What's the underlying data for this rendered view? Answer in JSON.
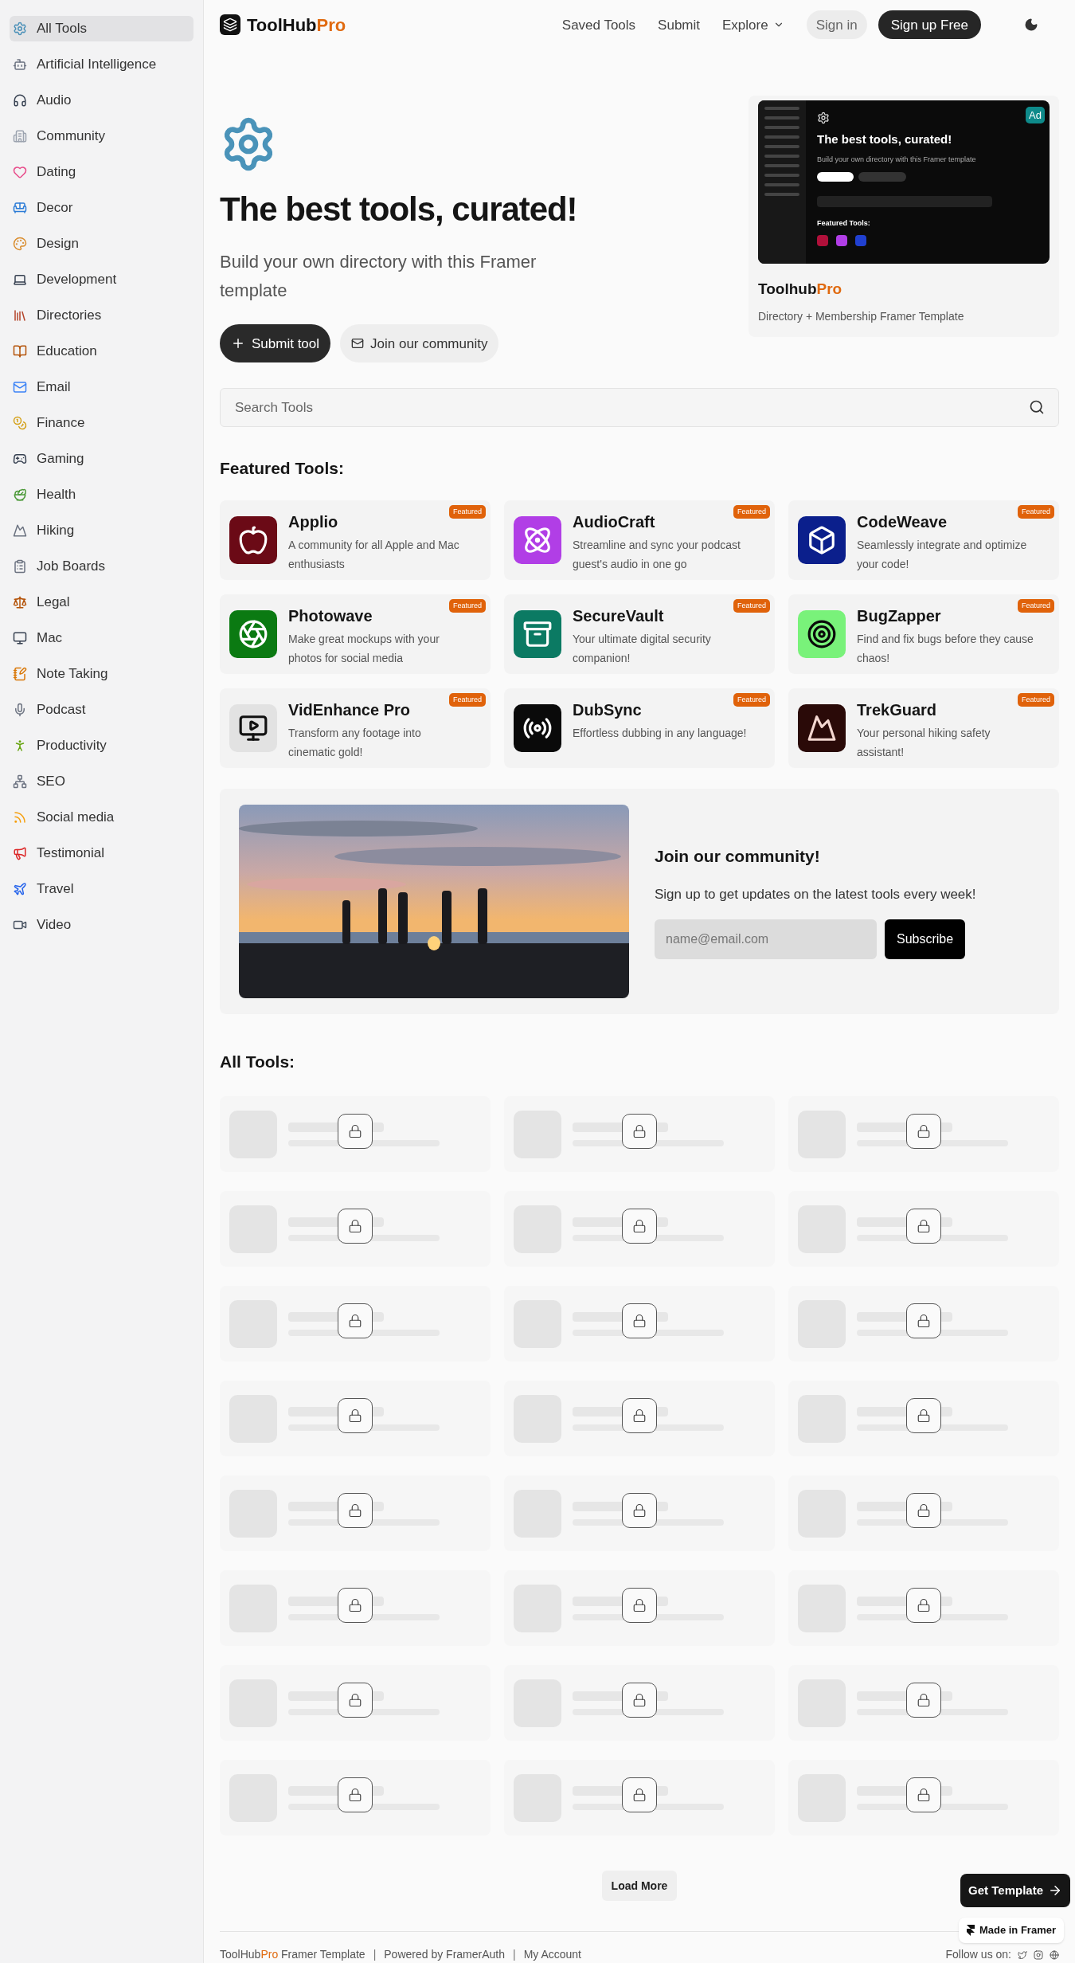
{
  "sidebar": {
    "items": [
      {
        "label": "All Tools",
        "selected": true
      },
      {
        "label": "Artificial Intelligence",
        "selected": false
      },
      {
        "label": "Audio",
        "selected": false
      },
      {
        "label": "Community",
        "selected": false
      },
      {
        "label": "Dating",
        "selected": false
      },
      {
        "label": "Decor",
        "selected": false
      },
      {
        "label": "Design",
        "selected": false
      },
      {
        "label": "Development",
        "selected": false
      },
      {
        "label": "Directories",
        "selected": false
      },
      {
        "label": "Education",
        "selected": false
      },
      {
        "label": "Email",
        "selected": false
      },
      {
        "label": "Finance",
        "selected": false
      },
      {
        "label": "Gaming",
        "selected": false
      },
      {
        "label": "Health",
        "selected": false
      },
      {
        "label": "Hiking",
        "selected": false
      },
      {
        "label": "Job Boards",
        "selected": false
      },
      {
        "label": "Legal",
        "selected": false
      },
      {
        "label": "Mac",
        "selected": false
      },
      {
        "label": "Note Taking",
        "selected": false
      },
      {
        "label": "Podcast",
        "selected": false
      },
      {
        "label": "Productivity",
        "selected": false
      },
      {
        "label": "SEO",
        "selected": false
      },
      {
        "label": "Social media",
        "selected": false
      },
      {
        "label": "Testimonial",
        "selected": false
      },
      {
        "label": "Travel",
        "selected": false
      },
      {
        "label": "Video",
        "selected": false
      }
    ]
  },
  "header": {
    "logo": {
      "name": "ToolHub",
      "suffix": "Pro"
    },
    "nav": [
      "Saved Tools",
      "Submit",
      "Explore"
    ],
    "sign_in": "Sign in",
    "sign_up": "Sign up Free"
  },
  "hero": {
    "title": "The best tools, curated!",
    "subtitle": "Build your own directory with this Framer template",
    "primary_button": "Submit tool",
    "secondary_button": "Join our community"
  },
  "ad": {
    "badge": "Ad",
    "name": "Toolhub",
    "name_suffix": "Pro",
    "description": "Directory + Membership Framer Template",
    "preview": {
      "title": "The best tools, curated!",
      "subtitle": "Build your own directory with this Framer template",
      "section": "Featured Tools:"
    }
  },
  "search": {
    "placeholder": "Search Tools"
  },
  "featured": {
    "title": "Featured Tools:",
    "tools": [
      {
        "name": "Applio",
        "description": "A community for all Apple and Mac enthusiasts",
        "badge": "Featured",
        "color": "#6b0a16"
      },
      {
        "name": "AudioCraft",
        "description": "Streamline and sync your podcast guest's audio in one go",
        "badge": "Featured",
        "color": "#b13ee6"
      },
      {
        "name": "CodeWeave",
        "description": "Seamlessly integrate and optimize your code!",
        "badge": "Featured",
        "color": "#0b1f8c"
      },
      {
        "name": "Photowave",
        "description": "Make great mockups with your photos for social media",
        "badge": "Featured",
        "color": "#0b7a12"
      },
      {
        "name": "SecureVault",
        "description": "Your ultimate digital security companion!",
        "badge": "Featured",
        "color": "#0b7a63"
      },
      {
        "name": "BugZapper",
        "description": "Find and fix bugs before they cause chaos!",
        "badge": "Featured",
        "color": "#79f27a"
      },
      {
        "name": "VidEnhance Pro",
        "description": "Transform any footage into cinematic gold!",
        "badge": "Featured",
        "color": "#e2e2e2"
      },
      {
        "name": "DubSync",
        "description": "Effortless dubbing in any language!",
        "badge": "Featured",
        "color": "#0a0a0a"
      },
      {
        "name": "TrekGuard",
        "description": "Your personal hiking safety assistant!",
        "badge": "Featured",
        "color": "#2a0a08"
      }
    ]
  },
  "community": {
    "title": "Join our community!",
    "text": "Sign up to get updates on the latest tools every week!",
    "email_placeholder": "name@email.com",
    "button": "Subscribe"
  },
  "all_tools": {
    "title": "All Tools:",
    "tools": [
      {
        "locked": true
      },
      {
        "locked": true
      },
      {
        "locked": true
      },
      {
        "locked": true
      },
      {
        "locked": true
      },
      {
        "locked": true
      },
      {
        "locked": true
      },
      {
        "locked": true
      },
      {
        "locked": true
      },
      {
        "locked": true
      },
      {
        "locked": true
      },
      {
        "locked": true
      },
      {
        "locked": true
      },
      {
        "locked": true
      },
      {
        "locked": true
      },
      {
        "locked": true
      },
      {
        "locked": true
      },
      {
        "locked": true
      },
      {
        "locked": true
      },
      {
        "locked": true
      },
      {
        "locked": true
      },
      {
        "locked": true
      },
      {
        "locked": true
      },
      {
        "locked": true
      }
    ],
    "load_more": "Load More"
  },
  "get_template": "Get Template",
  "made_in": "Made in Framer",
  "footer": {
    "brand": "ToolHub",
    "brand_suffix": "Pro",
    "brand_rest": "Framer Template",
    "links": [
      {
        "kind": "separator",
        "text": "|"
      },
      {
        "kind": "link",
        "text": "Powered by FramerAuth"
      },
      {
        "kind": "separator",
        "text": "|"
      },
      {
        "kind": "link",
        "text": "My Account"
      }
    ],
    "follow": "Follow us on:"
  }
}
